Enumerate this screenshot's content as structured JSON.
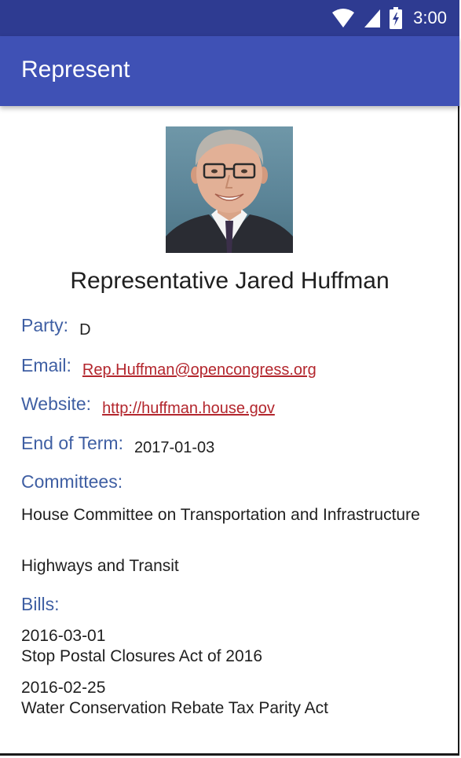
{
  "status_bar": {
    "time": "3:00",
    "icons": [
      "wifi-icon",
      "cell-signal-icon",
      "battery-charging-icon"
    ]
  },
  "app_bar": {
    "title": "Represent"
  },
  "representative": {
    "photo_alt": "Representative Jared Huffman",
    "name": "Representative Jared Huffman",
    "party_label": "Party:",
    "party": "D",
    "email_label": "Email:",
    "email": "Rep.Huffman@opencongress.org",
    "website_label": "Website:",
    "website": "http://huffman.house.gov",
    "end_of_term_label": "End of Term:",
    "end_of_term": "2017-01-03"
  },
  "committees": {
    "label": "Committees:",
    "items": [
      "House Committee on Transportation and Infrastructure",
      "Highways and Transit"
    ]
  },
  "bills": {
    "label": "Bills:",
    "items": [
      {
        "date": "2016-03-01",
        "title": "Stop Postal Closures Act of 2016"
      },
      {
        "date": "2016-02-25",
        "title": "Water Conservation Rebate Tax Parity Act"
      }
    ]
  },
  "colors": {
    "status_bar": "#2e3b91",
    "app_bar": "#3f51b5",
    "label": "#3f5fa3",
    "link": "#b3262d",
    "text": "#1f1f1f"
  }
}
